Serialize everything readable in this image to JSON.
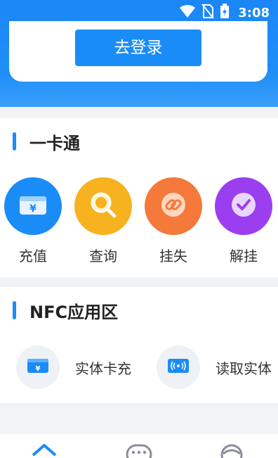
{
  "status_bar": {
    "time": "3:08"
  },
  "login": {
    "button_label": "去登录"
  },
  "card_section": {
    "title": "一卡通",
    "items": [
      {
        "label": "充值",
        "icon": "recharge-card-icon",
        "color": "#1a8cf8"
      },
      {
        "label": "查询",
        "icon": "search-icon",
        "color": "#f7b21f"
      },
      {
        "label": "挂失",
        "icon": "link-icon",
        "color": "#f5793a"
      },
      {
        "label": "解挂",
        "icon": "check-circle-icon",
        "color": "#9b3ef0"
      }
    ]
  },
  "nfc_section": {
    "title": "NFC应用区",
    "items": [
      {
        "label": "实体卡充",
        "icon": "card-recharge-icon"
      },
      {
        "label": "读取实体",
        "icon": "nfc-read-icon"
      }
    ]
  },
  "tab_bar": {
    "tabs": [
      {
        "icon": "home-icon",
        "active": true
      },
      {
        "icon": "message-icon",
        "active": false
      },
      {
        "icon": "profile-icon",
        "active": false
      }
    ]
  },
  "colors": {
    "accent": "#1a8cf8",
    "header": "#1f8ff8"
  }
}
